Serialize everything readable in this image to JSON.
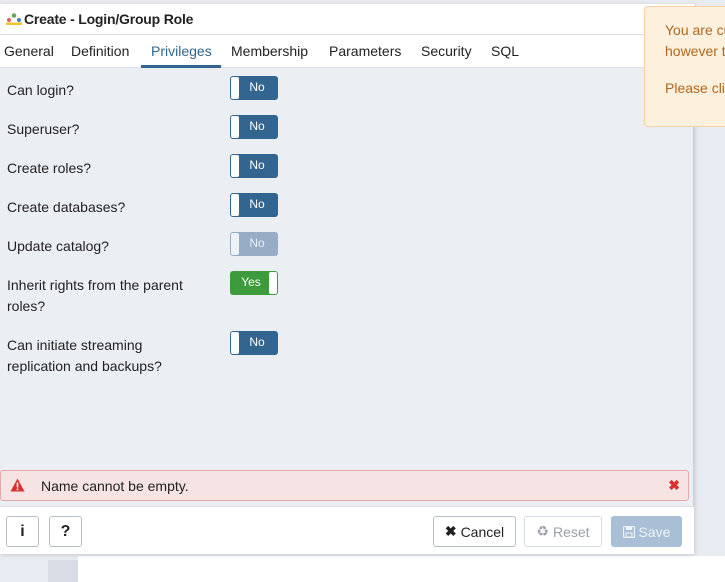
{
  "dialog": {
    "title": "Create - Login/Group Role",
    "title_icon": "role-icon"
  },
  "tabs": [
    {
      "label": "General"
    },
    {
      "label": "Definition"
    },
    {
      "label": "Privileges",
      "active": true
    },
    {
      "label": "Membership"
    },
    {
      "label": "Parameters"
    },
    {
      "label": "Security"
    },
    {
      "label": "SQL"
    }
  ],
  "privileges": [
    {
      "label": "Can login?",
      "value": "No",
      "state": "off"
    },
    {
      "label": "Superuser?",
      "value": "No",
      "state": "off"
    },
    {
      "label": "Create roles?",
      "value": "No",
      "state": "off"
    },
    {
      "label": "Create databases?",
      "value": "No",
      "state": "off"
    },
    {
      "label": "Update catalog?",
      "value": "No",
      "state": "disabled"
    },
    {
      "label_line1": "Inherit rights from the parent",
      "label_line2": "roles?",
      "value": "Yes",
      "state": "on"
    },
    {
      "label_line1": "Can initiate streaming",
      "label_line2": "replication and backups?",
      "value": "No",
      "state": "off"
    }
  ],
  "error": {
    "message": "Name cannot be empty.",
    "icon": "warning-icon",
    "close_icon": "close-icon",
    "color": "#d93030"
  },
  "footer": {
    "info_label": "i",
    "help_label": "?",
    "cancel_label": "Cancel",
    "reset_label": "Reset",
    "save_label": "Save"
  },
  "toast": {
    "line1": "You are cu",
    "line2": "however t",
    "line3": "Please cli"
  },
  "colors": {
    "accent": "#326690",
    "toggle_on": "#3d9b3d",
    "toggle_off": "#326690",
    "toggle_disabled": "#97adc6"
  }
}
